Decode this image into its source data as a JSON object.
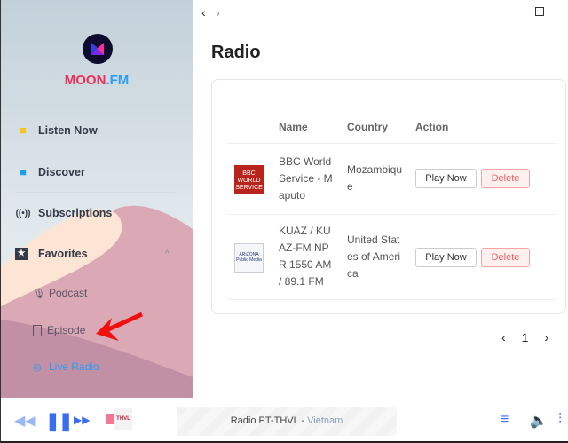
{
  "brand": {
    "name": "MOON",
    "suffix": ".FM"
  },
  "sidebar": {
    "items": [
      {
        "label": "Listen Now"
      },
      {
        "label": "Discover"
      },
      {
        "label": "Subscriptions"
      },
      {
        "label": "Favorites"
      }
    ],
    "sub": [
      {
        "label": "Podcast"
      },
      {
        "label": "Episode"
      },
      {
        "label": "Live Radio"
      }
    ]
  },
  "page": {
    "title": "Radio"
  },
  "table": {
    "headers": [
      "Name",
      "Country",
      "Action"
    ],
    "rows": [
      {
        "name": "BBC World Service - Maputo",
        "country": "Mozambique",
        "logo": "BBC WORLD SERVICE"
      },
      {
        "name": "KUAZ / KUAZ-FM NPR 1550 AM / 89.1 FM",
        "country": "United States of America",
        "logo": "ARIZONA Public Media"
      }
    ],
    "play_label": "Play Now",
    "delete_label": "Delete"
  },
  "pagination": {
    "current": "1"
  },
  "player": {
    "station": "Radio PT-THVL",
    "separator": " - ",
    "country": "Vietnam",
    "logo": "THVL"
  }
}
